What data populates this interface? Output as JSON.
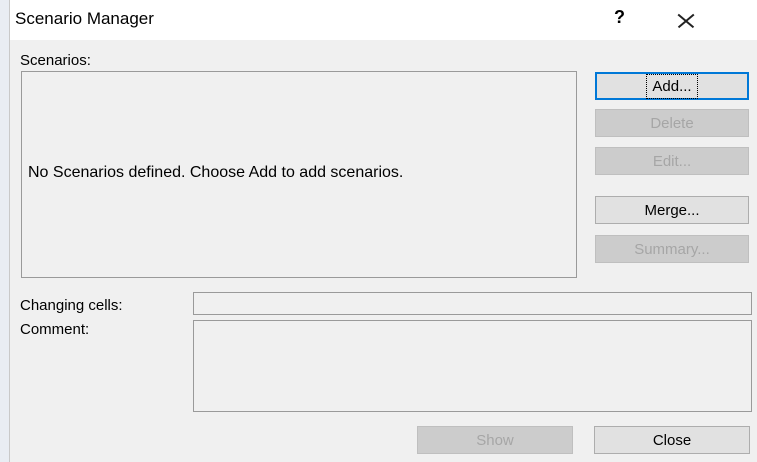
{
  "window": {
    "title": "Scenario Manager",
    "help_label": "?"
  },
  "scenarios": {
    "label": "Scenarios:",
    "empty_message": "No Scenarios defined. Choose Add to add scenarios."
  },
  "buttons": {
    "add": "Add...",
    "delete": "Delete",
    "edit": "Edit...",
    "merge": "Merge...",
    "summary": "Summary...",
    "show": "Show",
    "close": "Close"
  },
  "fields": {
    "changing_cells_label": "Changing cells:",
    "changing_cells_value": "",
    "comment_label": "Comment:",
    "comment_value": ""
  },
  "colors": {
    "dialog_bg": "#f0f0f0",
    "default_button_border": "#0078d7",
    "disabled_text": "#a6a6a6"
  }
}
